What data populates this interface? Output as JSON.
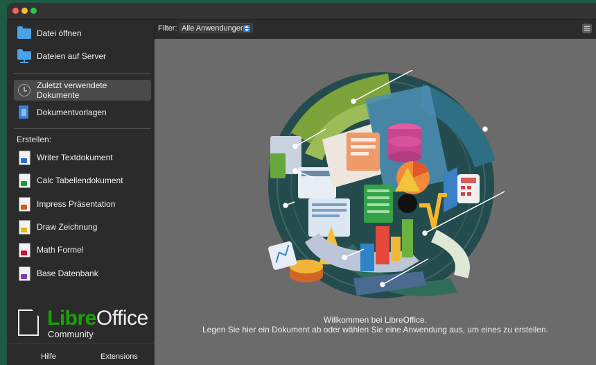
{
  "sidebar": {
    "open_file": "Datei öffnen",
    "remote_files": "Dateien auf Server",
    "recent": "Zuletzt verwendete Dokumente",
    "templates": "Dokumentvorlagen",
    "create_heading": "Erstellen:",
    "apps": [
      {
        "label": "Writer Textdokument",
        "icon": "writer-icon",
        "color": "#2a6ad6"
      },
      {
        "label": "Calc Tabellendokument",
        "icon": "calc-icon",
        "color": "#1d9b3e"
      },
      {
        "label": "Impress Präsentation",
        "icon": "impress-icon",
        "color": "#d9541c"
      },
      {
        "label": "Draw Zeichnung",
        "icon": "draw-icon",
        "color": "#e8b712"
      },
      {
        "label": "Math Formel",
        "icon": "math-icon",
        "color": "#c8102e"
      },
      {
        "label": "Base Datenbank",
        "icon": "base-icon",
        "color": "#7b3fb0"
      }
    ],
    "brand": {
      "libre": "Libre",
      "office": "Office",
      "community": "Community"
    },
    "help": "Hilfe",
    "extensions": "Extensions"
  },
  "topbar": {
    "filter_label": "Filter:",
    "filter_value": "Alle Anwendungen"
  },
  "main": {
    "welcome_line1": "Willkommen bei LibreOffice.",
    "welcome_line2": "Legen Sie hier ein Dokument ab oder wählen Sie eine Anwendung aus, um eines zu erstellen."
  },
  "colors": {
    "accent": "#2f7de1",
    "brand_green": "#18a303",
    "background_main": "#6b6b6b"
  }
}
